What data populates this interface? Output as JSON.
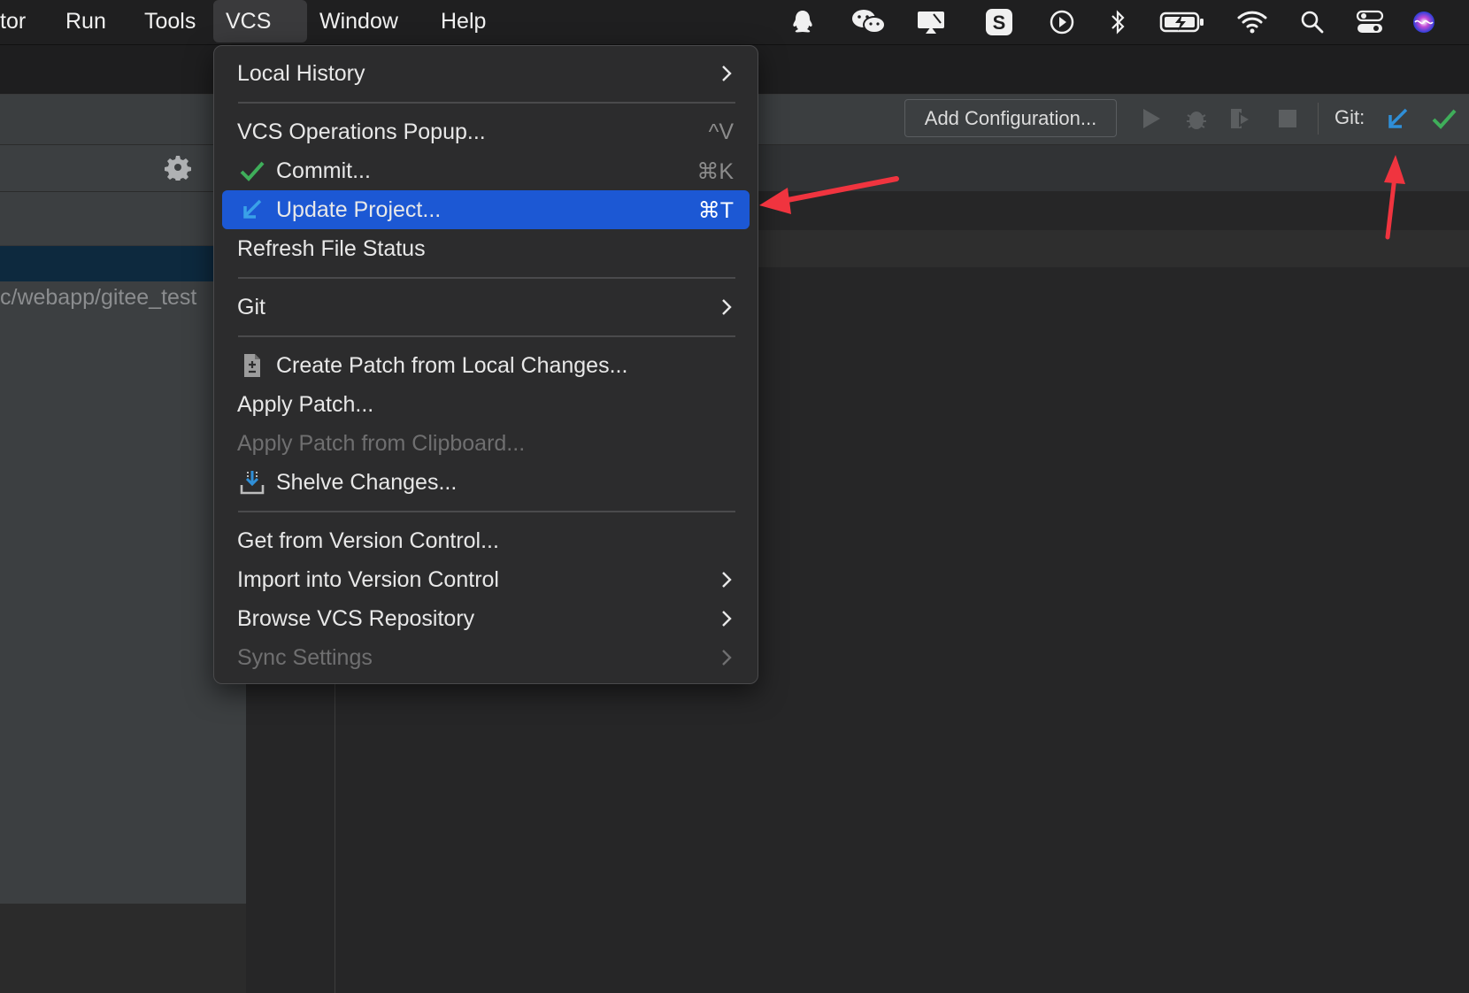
{
  "menubar": {
    "items": [
      {
        "label": "tor"
      },
      {
        "label": "Run"
      },
      {
        "label": "Tools"
      },
      {
        "label": "VCS"
      },
      {
        "label": "Window"
      },
      {
        "label": "Help"
      }
    ],
    "tray_icons": [
      "qq-icon",
      "wechat-icon",
      "screen-share-icon",
      "sogou-icon",
      "play-circle-icon",
      "bluetooth-icon",
      "battery-charging-icon",
      "wifi-icon",
      "search-icon",
      "control-center-icon",
      "siri-icon"
    ]
  },
  "sidebar": {
    "path_text": "c/webapp/gitee_test"
  },
  "toolbar": {
    "add_config_label": "Add Configuration...",
    "git_label": "Git:"
  },
  "vcs_menu": {
    "items": [
      {
        "label": "Local History",
        "submenu": true
      },
      {
        "label": "VCS Operations Popup...",
        "shortcut": "^V"
      },
      {
        "label": "Commit...",
        "shortcut": "⌘K",
        "icon": "check-icon"
      },
      {
        "label": "Update Project...",
        "shortcut": "⌘T",
        "icon": "update-arrow-icon",
        "highlighted": true
      },
      {
        "label": "Refresh File Status"
      },
      {
        "label": "Git",
        "submenu": true
      },
      {
        "label": "Create Patch from Local Changes...",
        "icon": "patch-file-icon"
      },
      {
        "label": "Apply Patch..."
      },
      {
        "label": "Apply Patch from Clipboard...",
        "disabled": true
      },
      {
        "label": "Shelve Changes...",
        "icon": "shelve-icon"
      },
      {
        "label": "Get from Version Control..."
      },
      {
        "label": "Import into Version Control",
        "submenu": true
      },
      {
        "label": "Browse VCS Repository",
        "submenu": true
      },
      {
        "label": "Sync Settings",
        "submenu": true,
        "disabled": true
      }
    ]
  },
  "colors": {
    "highlight": "#1c58d4",
    "annotation_arrow": "#f0343f",
    "update_icon": "#2f8fd8",
    "commit_icon": "#3fae5a"
  }
}
